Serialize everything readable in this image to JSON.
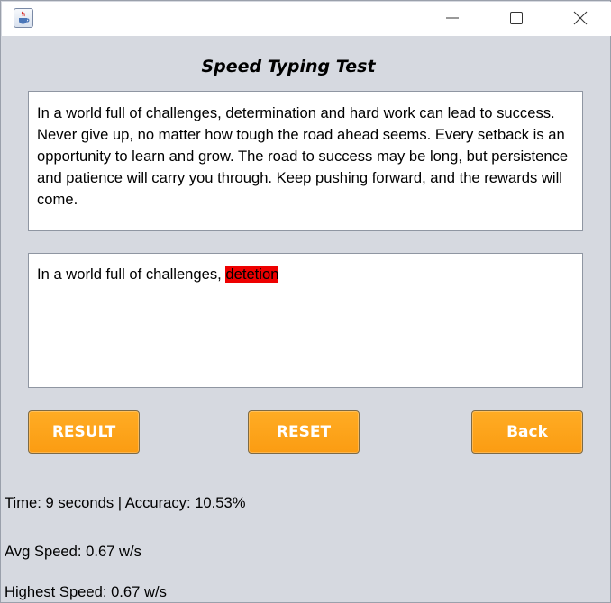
{
  "window": {
    "icon": "java-cup-icon",
    "controls": [
      "minimize-icon",
      "maximize-icon",
      "close-icon"
    ]
  },
  "heading": "Speed Typing Test",
  "prompt_text": "In a world full of challenges, determination and hard work can lead to success. Never give up, no matter how tough the road ahead seems. Every setback is an opportunity to learn and grow. The road to success may be long, but persistence and patience will carry you through. Keep pushing forward, and the rewards will come.",
  "typed": {
    "correct": "In a world full of challenges, ",
    "error": "detetion",
    "error_color": "#ee0000"
  },
  "buttons": {
    "result": "RESULT",
    "reset": "RESET",
    "back": "Back",
    "color": "#ffa21b"
  },
  "stats": {
    "time_accuracy": "Time: 9 seconds | Accuracy: 10.53%",
    "avg_speed": "Avg Speed: 0.67 w/s",
    "highest_speed": "Highest Speed: 0.67 w/s"
  }
}
